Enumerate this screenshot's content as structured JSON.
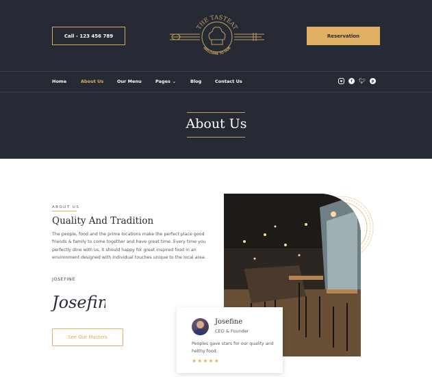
{
  "header": {
    "call_label": "Call - 123 456 789",
    "reservation_label": "Reservation",
    "logo_top_text": "THE TASTEAT",
    "logo_bottom_text": "WELCOME TO OUR"
  },
  "nav": {
    "items": [
      {
        "label": "Home"
      },
      {
        "label": "About Us"
      },
      {
        "label": "Our Menu"
      },
      {
        "label": "Pages"
      },
      {
        "label": "Blog"
      },
      {
        "label": "Contact Us"
      }
    ],
    "active_index": 1,
    "social_icons": [
      "instagram-icon",
      "facebook-icon",
      "twitter-icon",
      "pinterest-icon"
    ]
  },
  "hero": {
    "title": "About Us"
  },
  "about": {
    "eyebrow": "ABOUT US",
    "heading": "Quality And  Tradition",
    "paragraph": "The people, food and the prime locations make the perfect place good friends & family to come together and have great time. Every time you perfectly dine with us, it should happy for great inspired food in an environment designed with individual touches unique to the local area.",
    "signature_name": "JOSEFINE",
    "signature_script": "Josefine",
    "button_label": "See Our Masters"
  },
  "testimonial": {
    "name": "Josefine",
    "role": "CEO & Founder",
    "text": "Peoples gave stars for our quality and helthy food.",
    "stars": "★★★★★",
    "rating": 5
  },
  "colors": {
    "dark": "#262a34",
    "accent": "#e0b062"
  }
}
